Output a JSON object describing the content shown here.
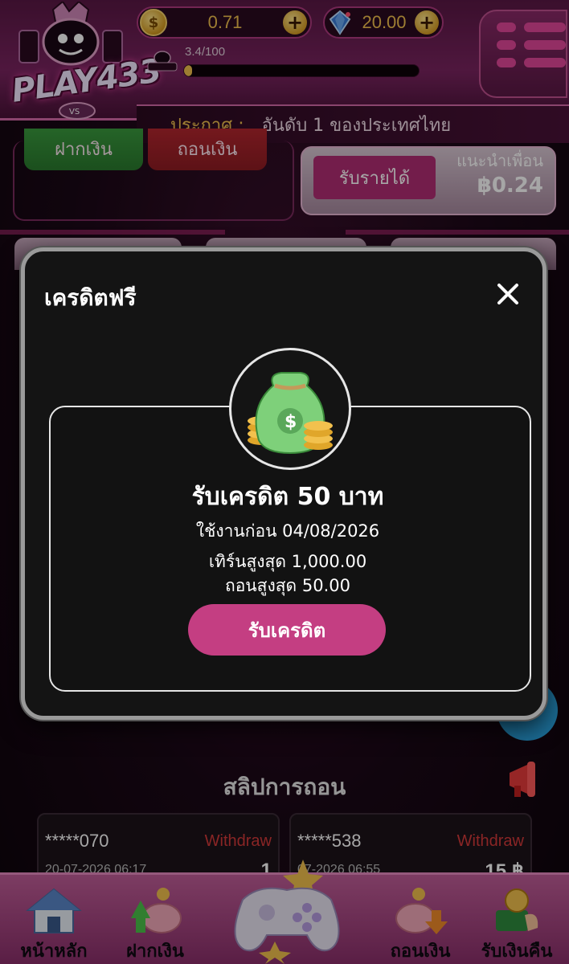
{
  "header": {
    "brand_logo": "PLAY433",
    "coin_balance": "0.71",
    "gem_balance": "20.00",
    "level_progress_text": "3.4/100",
    "level_progress_fraction": 0.034,
    "announcement_label": "ประกาศ :",
    "announcement_text": "อันดับ 1 ของประเทศไทย"
  },
  "background": {
    "deposit_label": "ฝากเงิน",
    "withdraw_label": "ถอนเงิน",
    "income_button": "รับรายได้",
    "referral_label": "แนะนำเพื่อน",
    "referral_value": "฿0.24",
    "slip_title": "สลิปการถอน",
    "slips": [
      {
        "user": "*****070",
        "type": "Withdraw",
        "date": "20-07-2026 06:17",
        "amount": "1"
      },
      {
        "user": "*****538",
        "type": "Withdraw",
        "date": "07-2026 06:55",
        "amount": "15 ฿"
      }
    ]
  },
  "modal": {
    "title": "เครดิตฟรี",
    "heading": "รับเครดิต 50 บาท",
    "use_before": "ใช้งานก่อน 04/08/2026",
    "turnover_max": "เทิร์นสูงสุด 1,000.00",
    "withdraw_max": "ถอนสูงสุด 50.00",
    "claim_button": "รับเครดิต"
  },
  "bottom_nav": {
    "items": [
      {
        "label": "หน้าหลัก",
        "icon": "house-icon"
      },
      {
        "label": "ฝากเงิน",
        "icon": "piggy-deposit-icon"
      },
      {
        "label": "",
        "icon": "gamepad-icon"
      },
      {
        "label": "ถอนเงิน",
        "icon": "piggy-withdraw-icon"
      },
      {
        "label": "รับเงินคืน",
        "icon": "cashback-icon"
      }
    ]
  },
  "colors": {
    "brand_pink": "#c43e82",
    "gold": "#f2c14e",
    "withdraw_red": "#d43a3a"
  }
}
